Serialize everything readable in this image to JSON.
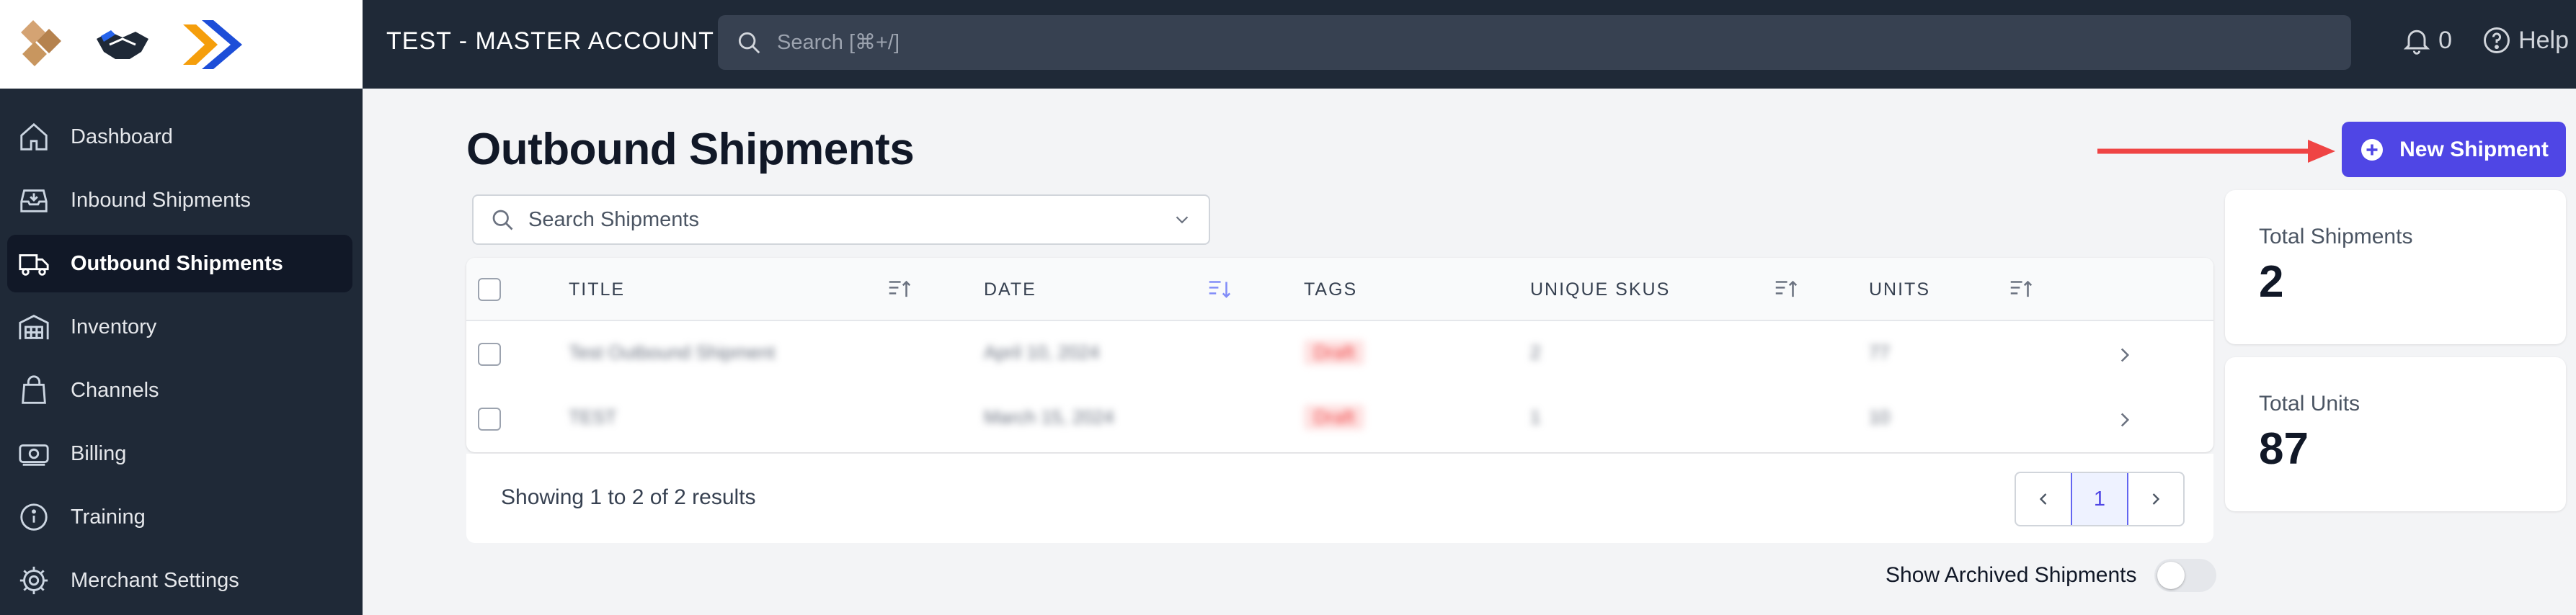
{
  "header": {
    "account_name": "TEST - MASTER ACCOUNT",
    "search_placeholder": "Search [⌘+/]",
    "notification_count": "0",
    "help_label": "Help"
  },
  "sidebar": {
    "items": [
      {
        "label": "Dashboard",
        "icon": "home-icon",
        "active": false
      },
      {
        "label": "Inbound Shipments",
        "icon": "inbox-icon",
        "active": false
      },
      {
        "label": "Outbound Shipments",
        "icon": "truck-icon",
        "active": true
      },
      {
        "label": "Inventory",
        "icon": "warehouse-icon",
        "active": false
      },
      {
        "label": "Channels",
        "icon": "shopping-bag-icon",
        "active": false
      },
      {
        "label": "Billing",
        "icon": "cash-icon",
        "active": false
      },
      {
        "label": "Training",
        "icon": "info-icon",
        "active": false
      },
      {
        "label": "Merchant Settings",
        "icon": "gear-icon",
        "active": false
      }
    ]
  },
  "main": {
    "title": "Outbound Shipments",
    "new_button_label": "New Shipment",
    "search_placeholder": "Search Shipments",
    "table": {
      "columns": [
        "TITLE",
        "DATE",
        "TAGS",
        "UNIQUE SKUS",
        "UNITS"
      ],
      "rows": [
        {
          "title": "Test Outbound Shipment",
          "date": "April 10, 2024",
          "tag": "Draft",
          "unique_skus": "2",
          "units": "77"
        },
        {
          "title": "TEST",
          "date": "March 15, 2024",
          "tag": "Draft",
          "unique_skus": "1",
          "units": "10"
        }
      ]
    },
    "pagination": {
      "showing_text": "Showing 1 to 2 of 2 results",
      "current_page": "1"
    },
    "show_archived_label": "Show Archived Shipments",
    "show_archived_on": false
  },
  "stats": [
    {
      "label": "Total Shipments",
      "value": "2"
    },
    {
      "label": "Total Units",
      "value": "87"
    }
  ],
  "colors": {
    "sidebar_bg": "#1f2937",
    "accent": "#4f46e5",
    "annotation_arrow": "#ef4444",
    "page_bg": "#f3f4f6"
  }
}
